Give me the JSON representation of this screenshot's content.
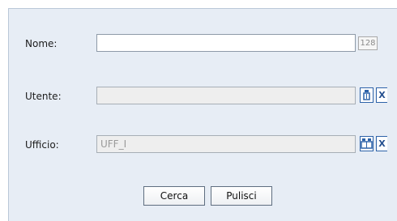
{
  "form": {
    "name": {
      "label": "Nome:",
      "value": "",
      "max_badge": "128"
    },
    "user": {
      "label": "Utente:",
      "value": "",
      "pick_icon": "user-picker-icon",
      "clear_icon": "clear-x-icon",
      "clear_label": "X"
    },
    "office": {
      "label": "Ufficio:",
      "value": "UFF_I",
      "pick_icon": "group-picker-icon",
      "clear_icon": "clear-x-icon",
      "clear_label": "X"
    }
  },
  "actions": {
    "search_label": "Cerca",
    "reset_label": "Pulisci"
  },
  "colors": {
    "panel_bg": "#e7edf5",
    "icon_blue": "#2d62a8",
    "disabled_field": "#eeeeee"
  }
}
